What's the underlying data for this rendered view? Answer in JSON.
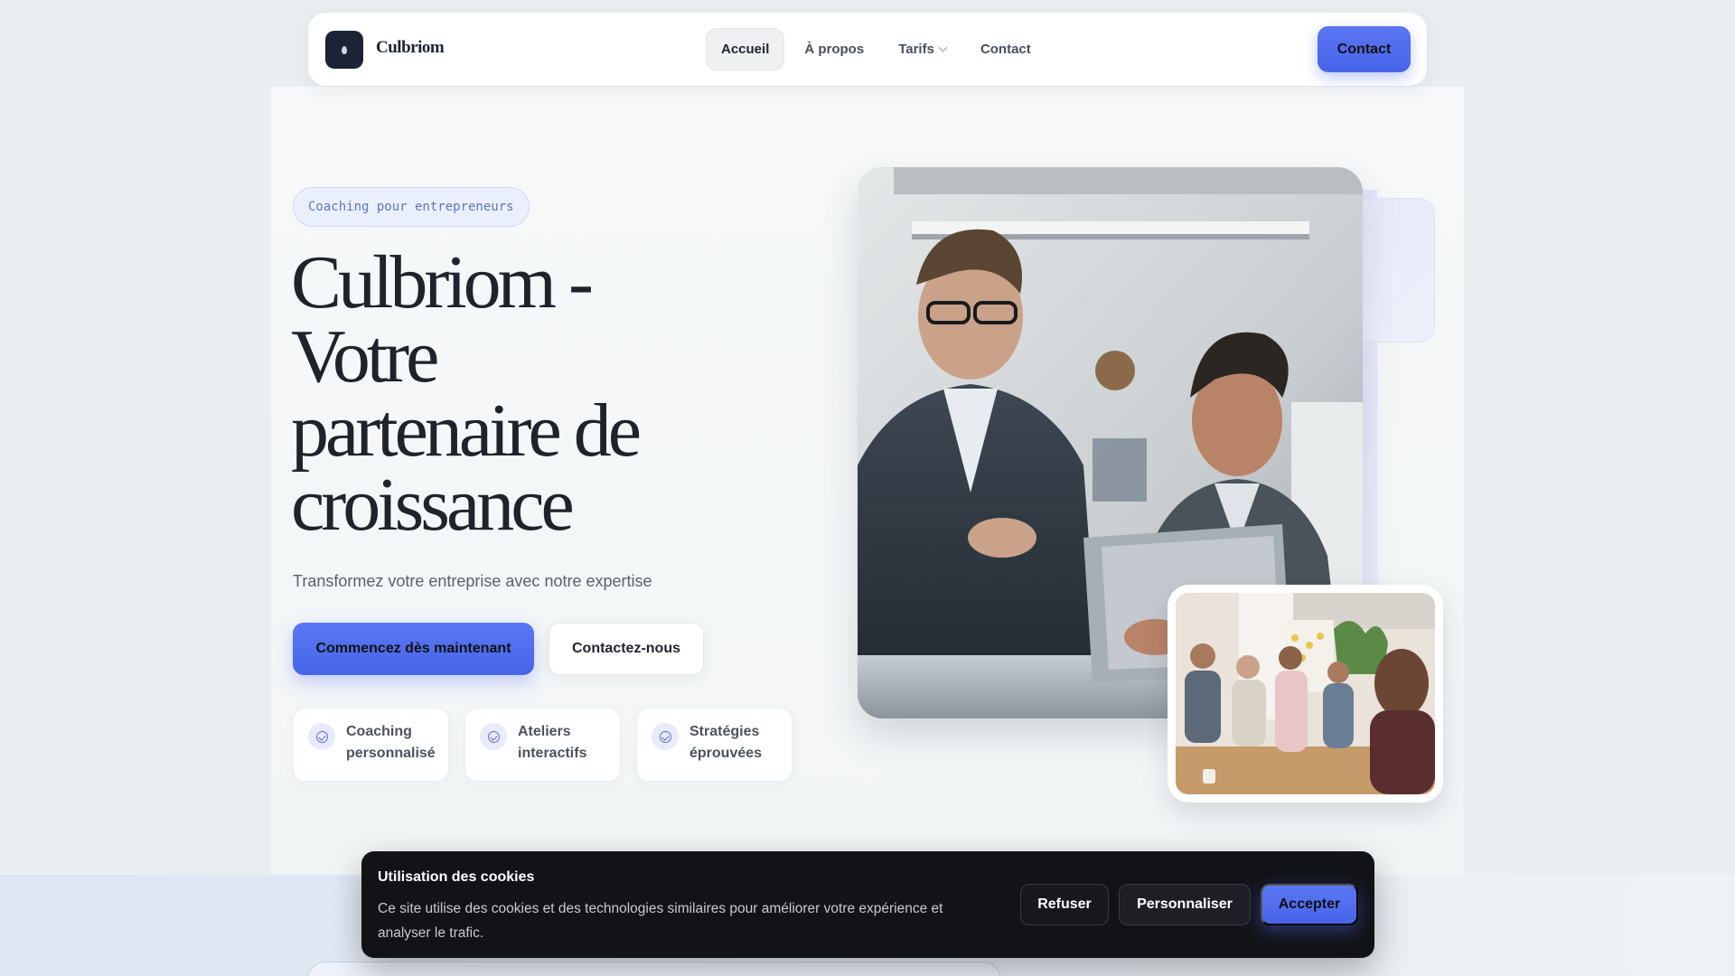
{
  "nav": {
    "brand": "Culbriom",
    "links": [
      "Accueil",
      "À propos",
      "Tarifs",
      "Contact"
    ],
    "cta": "Contact"
  },
  "hero": {
    "badge": "Coaching pour entrepreneurs",
    "title": "Culbriom - Votre partenaire de croissance",
    "subtitle": "Transformez votre entreprise avec notre expertise",
    "primary_button": "Commencez dès maintenant",
    "secondary_button": "Contactez-nous",
    "features": [
      "Coaching personnalisé",
      "Ateliers interactifs",
      "Stratégies éprouvées"
    ]
  },
  "cookie": {
    "title": "Utilisation des cookies",
    "text": "Ce site utilise des cookies et des technologies similaires pour améliorer votre expérience et analyser le trafic.",
    "refuse": "Refuser",
    "customize": "Personnaliser",
    "accept": "Accepter"
  },
  "colors": {
    "accent": "#4a67eb",
    "dark": "#121317",
    "background": "#e9eff1"
  }
}
